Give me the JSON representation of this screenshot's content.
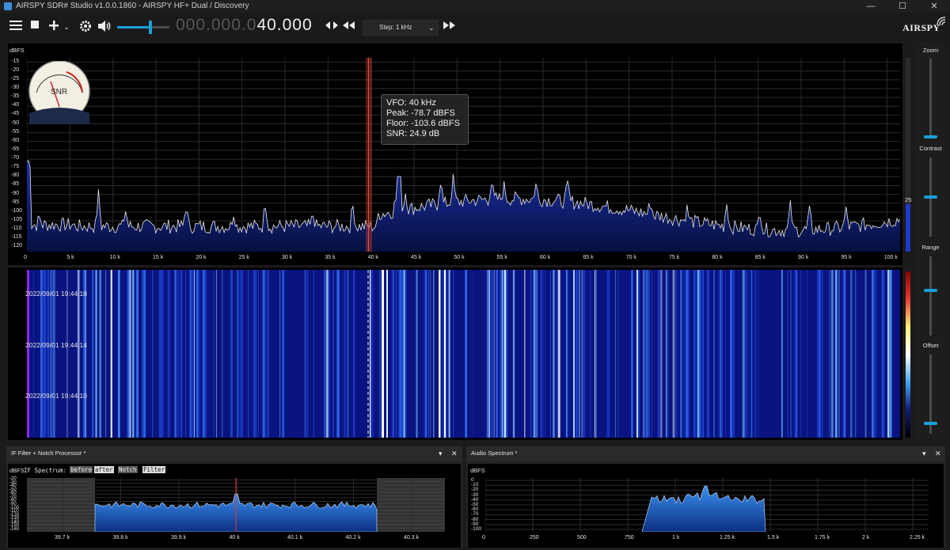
{
  "app": {
    "title": "AIRSPY SDR# Studio v1.0.0.1860 - AIRSPY HF+ Dual / Discovery",
    "logo": "AIRSPY"
  },
  "window_controls": {
    "minimize": "—",
    "maximize": "☐",
    "close": "✕"
  },
  "toolbar": {
    "freq_dim": "000.000.0",
    "freq_bright": "40.000",
    "step_label": "Step: 1 kHz"
  },
  "spectrum": {
    "unit": "dBFS",
    "y_ticks": [
      "-15",
      "-20",
      "-25",
      "-30",
      "-35",
      "-40",
      "-45",
      "-50",
      "-55",
      "-60",
      "-65",
      "-70",
      "-75",
      "-80",
      "-85",
      "-90",
      "-95",
      "-100",
      "-105",
      "-110",
      "-115",
      "-120"
    ],
    "x_ticks": [
      "0",
      "5 k",
      "10 k",
      "15 k",
      "20 k",
      "25 k",
      "30 k",
      "35 k",
      "40 k",
      "45 k",
      "50 k",
      "55 k",
      "60 k",
      "65 k",
      "70 k",
      "75 k",
      "80 k",
      "85 k",
      "90 k",
      "95 k",
      "100 k"
    ],
    "level_value": "25",
    "snr_label": "SNR",
    "tooltip": {
      "vfo": "VFO:  40 kHz",
      "peak": "Peak:  -78.7 dBFS",
      "floor": "Floor:  -103.6 dBFS",
      "snr": "SNR:  24.9 dB"
    }
  },
  "waterfall": {
    "timestamps": [
      "2022/09/01 19:44:18",
      "2022/09/01 19:44:14",
      "2022/09/01 19:44:10"
    ]
  },
  "sidebar": {
    "zoom": "Zoom",
    "contrast": "Contrast",
    "range": "Range",
    "offset": "Offset"
  },
  "if_panel": {
    "title": "IF Filter + Notch Processor *",
    "unit": "dBFS",
    "spectrum_label": "IF Spectrum:",
    "btn_before": "before",
    "btn_after": "after",
    "btn_notch": "Notch",
    "btn_filter": "Filter",
    "y_ticks": [
      "-20",
      "-30",
      "-40",
      "-50",
      "-60",
      "-70",
      "-80",
      "-90",
      "-100",
      "-110",
      "-120",
      "-130",
      "-140",
      "-150",
      "-160"
    ],
    "x_ticks": [
      "39.7 k",
      "39.8 k",
      "39.9 k",
      "40 k",
      "40.1 k",
      "40.2 k",
      "40.3 k"
    ]
  },
  "audio_panel": {
    "title": "Audio Spectrum *",
    "unit": "dBFS",
    "y_ticks": [
      "0",
      "-10",
      "-20",
      "-30",
      "-40",
      "-50",
      "-60",
      "-70",
      "-80",
      "-90",
      "-100"
    ],
    "x_ticks": [
      "0",
      "250",
      "500",
      "750",
      "1 k",
      "1.25 k",
      "1.5 k",
      "1.75 k",
      "2 k",
      "2.25 k"
    ]
  },
  "panel_controls": {
    "dropdown": "▾",
    "close": "✕"
  },
  "colors": {
    "accent": "#1a9fd8",
    "spectrum_fill": "#0a1a66",
    "waterfall_bg": "#0a1480",
    "if_fill": "#1e6fd0",
    "vfo_marker": "#c0392b"
  }
}
